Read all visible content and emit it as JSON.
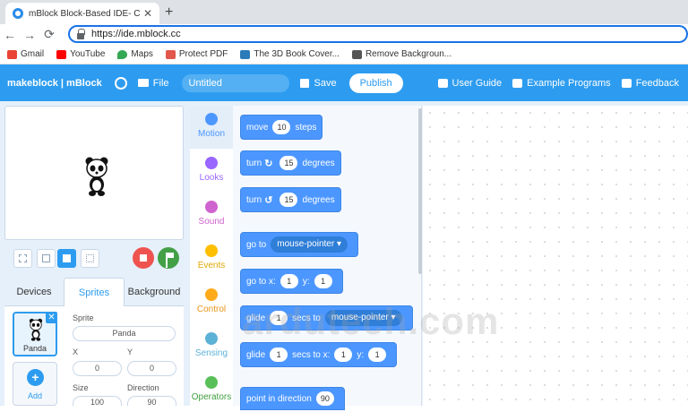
{
  "browser": {
    "tab_title": "mBlock Block-Based IDE- Coding",
    "tab_close": "✕",
    "new_tab": "+",
    "url": "https://ide.mblock.cc",
    "back": "←",
    "forward": "→",
    "reload": "⟳",
    "bookmarks": [
      {
        "label": "Gmail",
        "icon": "gmail-icon",
        "color": "#ea4335"
      },
      {
        "label": "YouTube",
        "icon": "youtube-icon",
        "color": "#ff0000"
      },
      {
        "label": "Maps",
        "icon": "maps-icon",
        "color": "#34a853"
      },
      {
        "label": "Protect PDF",
        "icon": "pdf-icon",
        "color": "#e2574c"
      },
      {
        "label": "The 3D Book Cover...",
        "icon": "book-icon",
        "color": "#2b7bb9"
      },
      {
        "label": "Remove Backgroun...",
        "icon": "layers-icon",
        "color": "#555555"
      }
    ]
  },
  "header": {
    "brand": "makeblock | mBlock",
    "file_label": "File",
    "project_title": "Untitled",
    "save_label": "Save",
    "publish_label": "Publish",
    "user_guide": "User Guide",
    "example_programs": "Example Programs",
    "feedback": "Feedback"
  },
  "panel_tabs": [
    "Devices",
    "Sprites",
    "Background"
  ],
  "sprite": {
    "card_label": "Panda",
    "card_close": "✕",
    "add_plus": "+",
    "add_label": "Add",
    "sprite_label": "Sprite",
    "name": "Panda",
    "x_label": "X",
    "y_label": "Y",
    "x": "0",
    "y": "0",
    "size_label": "Size",
    "direction_label": "Direction",
    "size": "100",
    "direction": "90"
  },
  "categories": [
    {
      "label": "Motion",
      "color": "#4c97ff"
    },
    {
      "label": "Looks",
      "color": "#9966ff"
    },
    {
      "label": "Sound",
      "color": "#cf63cf"
    },
    {
      "label": "Events",
      "color": "#ffbf00"
    },
    {
      "label": "Control",
      "color": "#ffab19"
    },
    {
      "label": "Sensing",
      "color": "#5cb1d6"
    },
    {
      "label": "Operators",
      "color": "#59c059"
    }
  ],
  "blocks": {
    "move": {
      "a": "move",
      "v": "10",
      "b": "steps"
    },
    "turn_cw": {
      "a": "turn",
      "icon": "↻",
      "v": "15",
      "b": "degrees"
    },
    "turn_ccw": {
      "a": "turn",
      "icon": "↺",
      "v": "15",
      "b": "degrees"
    },
    "goto": {
      "a": "go to",
      "d": "mouse-pointer ▾"
    },
    "goto_xy": {
      "a": "go to x:",
      "x": "1",
      "b": "y:",
      "y": "1"
    },
    "glide_to": {
      "a": "glide",
      "v": "1",
      "b": "secs to",
      "d": "mouse-pointer ▾"
    },
    "glide_xy": {
      "a": "glide",
      "v": "1",
      "b": "secs to x:",
      "x": "1",
      "c": "y:",
      "y": "1"
    },
    "point": {
      "a": "point in direction",
      "v": "90"
    }
  },
  "watermark": "ardutech.com"
}
